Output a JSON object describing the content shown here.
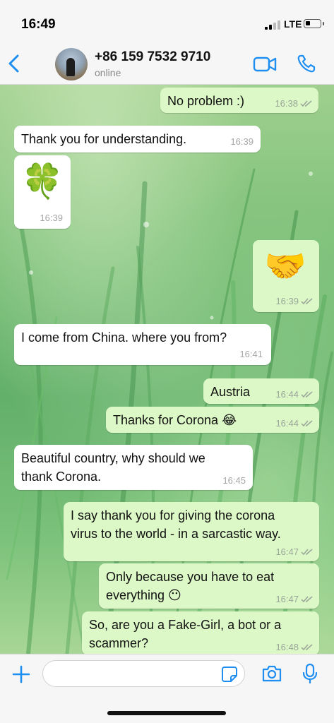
{
  "status_bar": {
    "time": "16:49",
    "network": "LTE",
    "battery_level": 0.22
  },
  "header": {
    "contact_name": "+86 159 7532 9710",
    "contact_status": "online",
    "accent_color": "#1f8ef1"
  },
  "messages": [
    {
      "dir": "out",
      "text": "No problem :)",
      "time": "16:38",
      "read": true
    },
    {
      "dir": "in",
      "text": "Thank you for understanding.",
      "time": "16:39"
    },
    {
      "dir": "in",
      "emoji": "🍀",
      "emoji_name": "four-leaf-clover",
      "time": "16:39"
    },
    {
      "dir": "out",
      "emoji": "🤝",
      "emoji_name": "handshake",
      "time": "16:39",
      "read": true
    },
    {
      "dir": "in",
      "text": "I come from China. where you from?",
      "time": "16:41"
    },
    {
      "dir": "out",
      "text": "Austria",
      "time": "16:44",
      "read": true
    },
    {
      "dir": "out",
      "text": "Thanks for Corona 😂",
      "time": "16:44",
      "read": true
    },
    {
      "dir": "in",
      "text": "Beautiful country, why should we\nthank Corona.",
      "time": "16:45"
    },
    {
      "dir": "out",
      "text": "I say thank you for giving the corona\nvirus to the world - in a sarcastic way.",
      "time": "16:47",
      "read": true
    },
    {
      "dir": "out",
      "text": "Only because you have to eat\neverything 😶",
      "time": "16:47",
      "read": true
    },
    {
      "dir": "out",
      "text": "So, are you a Fake-Girl, a bot or a\nscammer?",
      "time": "16:48",
      "read": true
    }
  ],
  "input": {
    "value": "",
    "placeholder": ""
  },
  "colors": {
    "outgoing_bubble": "#dcf8c6",
    "incoming_bubble": "#ffffff",
    "bar_background": "#f6f6f6"
  },
  "icons": [
    "back-chevron-icon",
    "video-call-icon",
    "phone-icon",
    "plus-icon",
    "sticker-icon",
    "camera-icon",
    "microphone-icon"
  ]
}
